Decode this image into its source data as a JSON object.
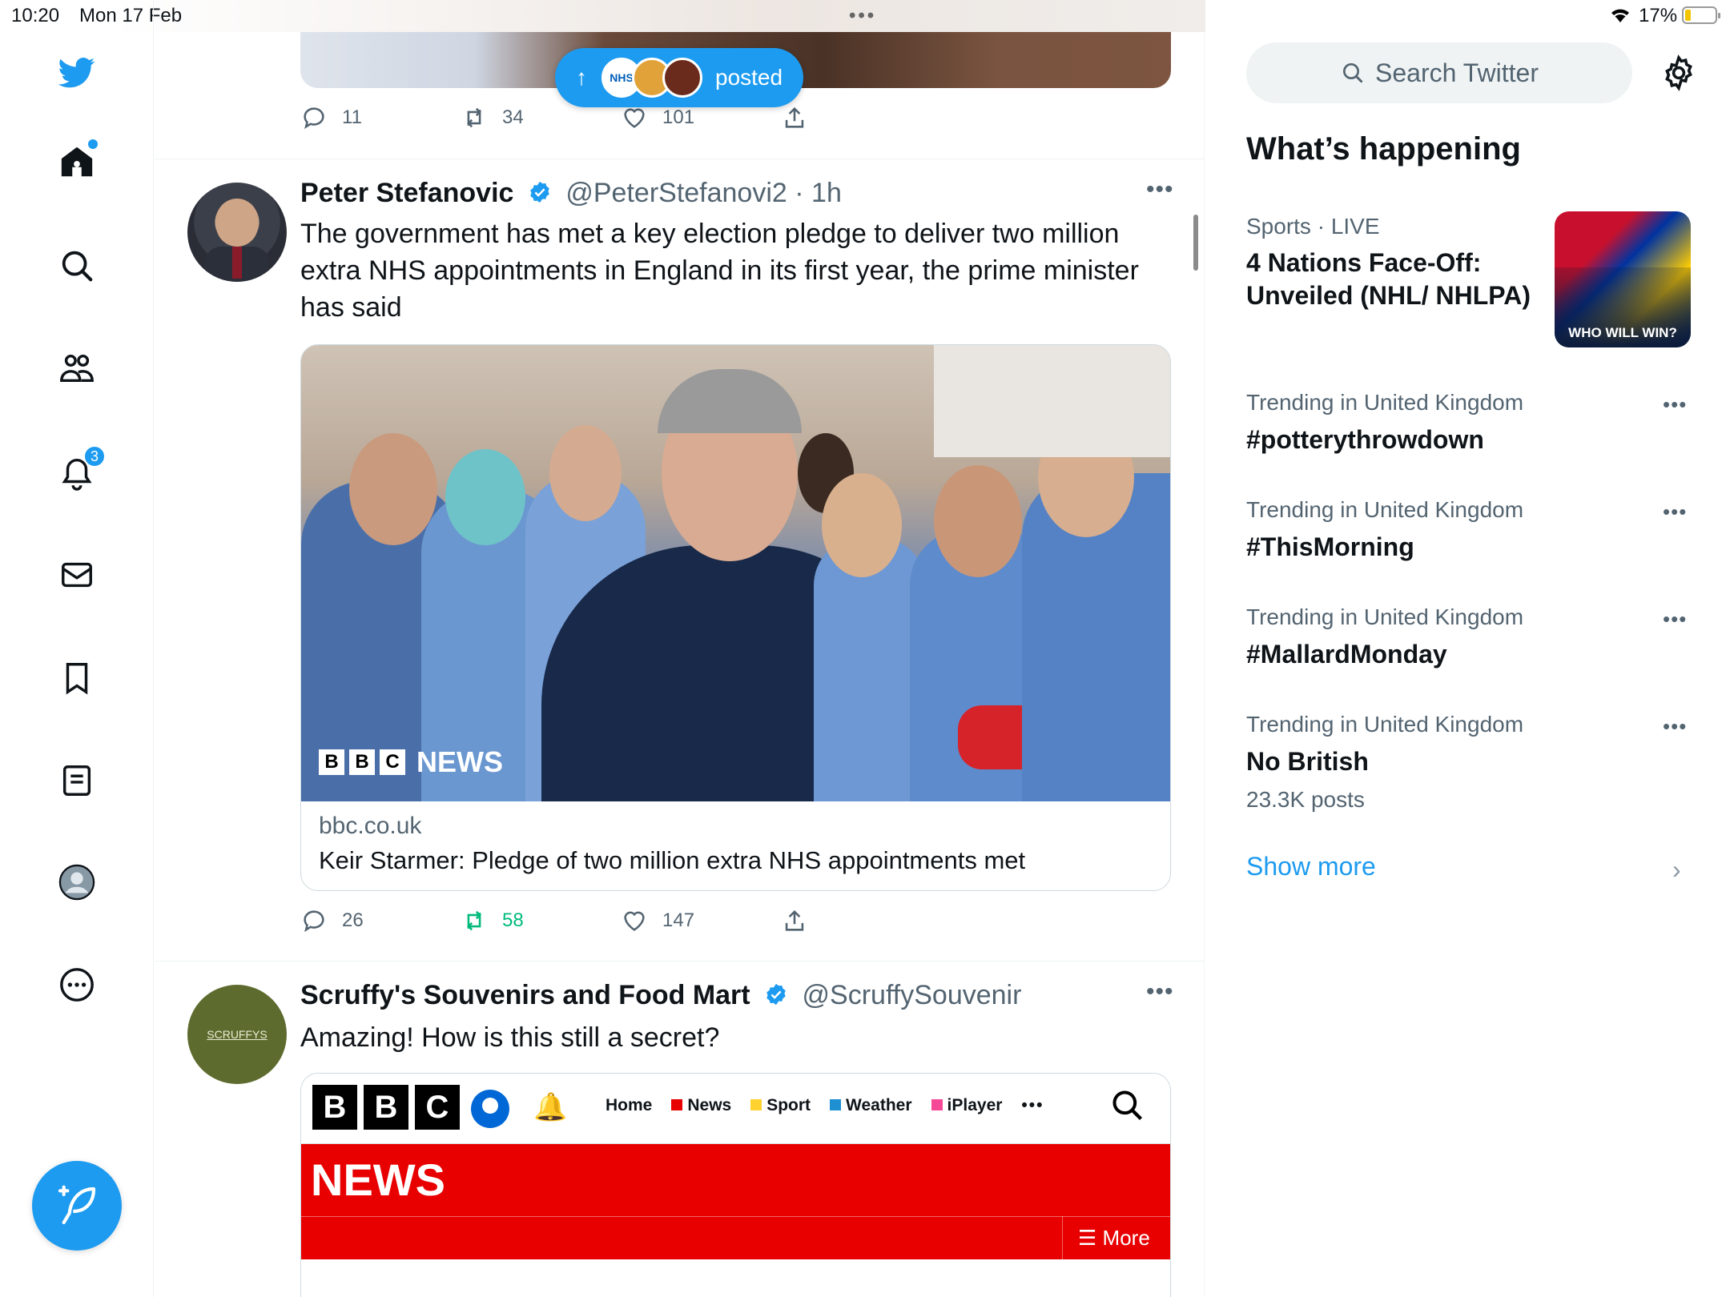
{
  "status_bar": {
    "time": "10:20",
    "date": "Mon 17 Feb",
    "battery": "17%"
  },
  "nav": {
    "notifications_badge": "3"
  },
  "posted_pill": {
    "label": "posted"
  },
  "top_tweet": {
    "replies": "11",
    "retweets": "34",
    "likes": "101"
  },
  "tweets": [
    {
      "name": "Peter Stefanovic",
      "handle": "@PeterStefanovi2",
      "time": "· 1h",
      "text": "The government has met a key election pledge to deliver two million extra NHS appointments in England in its first year, the prime minister has said",
      "card": {
        "image_watermark": "NEWS",
        "bbc_letters": [
          "B",
          "B",
          "C"
        ],
        "domain": "bbc.co.uk",
        "title": "Keir Starmer: Pledge of two million extra NHS appointments met"
      },
      "replies": "26",
      "retweets": "58",
      "likes": "147"
    },
    {
      "name": "Scruffy's Souvenirs and Food Mart",
      "handle": "@ScruffySouvenir",
      "avatar_text": "SCRUFFYS",
      "text": "Amazing! How is this still a secret?",
      "card": {
        "bbc_letters": [
          "B",
          "B",
          "C"
        ],
        "nav_items": [
          "Home",
          "News",
          "Sport",
          "Weather",
          "iPlayer"
        ],
        "banner": "NEWS",
        "more": "More"
      }
    }
  ],
  "sidebar": {
    "search_placeholder": "Search Twitter",
    "heading": "What’s happening",
    "featured": {
      "category": "Sports",
      "live": "· LIVE",
      "title": "4 Nations Face-Off: Unveiled (NHL/ NHLPA)",
      "image_caption": "WHO WILL WIN?"
    },
    "trends": [
      {
        "meta": "Trending in United Kingdom",
        "title": "#potterythrowdown"
      },
      {
        "meta": "Trending in United Kingdom",
        "title": "#ThisMorning"
      },
      {
        "meta": "Trending in United Kingdom",
        "title": "#MallardMonday"
      },
      {
        "meta": "Trending in United Kingdom",
        "title": "No British",
        "posts": "23.3K posts"
      }
    ],
    "show_more": "Show more"
  },
  "colors": {
    "twitter_blue": "#1d9bf0",
    "retweet_green": "#00ba7c",
    "bbc_red": "#e80000",
    "text_secondary": "#536471"
  }
}
